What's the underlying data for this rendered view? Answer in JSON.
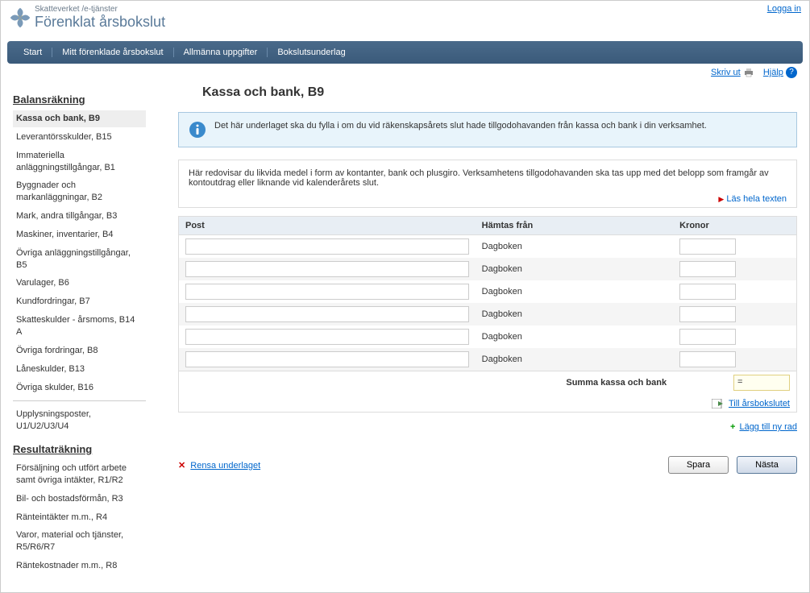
{
  "header": {
    "login": "Logga in",
    "subtitle": "Skatteverket /e-tjänster",
    "title": "Förenklat årsbokslut"
  },
  "nav": [
    "Start",
    "Mitt förenklade årsbokslut",
    "Allmänna uppgifter",
    "Bokslutsunderlag"
  ],
  "toolbar": {
    "print": "Skriv ut",
    "help": "Hjälp"
  },
  "sidebar": {
    "balans": {
      "title": "Balansräkning",
      "items": [
        "Kassa och bank, B9",
        "Leverantörsskulder, B15",
        "Immateriella anläggningstillgångar, B1",
        "Byggnader och markanläggningar, B2",
        "Mark, andra tillgångar, B3",
        "Maskiner, inventarier, B4",
        "Övriga anläggningstillgångar, B5",
        "Varulager, B6",
        "Kundfordringar, B7",
        "Skatteskulder - årsmoms, B14 A",
        "Övriga fordringar, B8",
        "Låneskulder, B13",
        "Övriga skulder, B16"
      ],
      "extra": "Upplysningsposter, U1/U2/U3/U4"
    },
    "resultat": {
      "title": "Resultaträkning",
      "items": [
        "Försäljning och utfört arbete samt övriga intäkter, R1/R2",
        "Bil- och bostadsförmån, R3",
        "Ränteintäkter m.m., R4",
        "Varor, material och tjänster, R5/R6/R7",
        "Räntekostnader m.m., R8"
      ]
    }
  },
  "content": {
    "title": "Kassa och bank, B9",
    "info": "Det här underlaget ska du fylla i om du vid räkenskapsårets slut hade tillgodohavanden från kassa och bank i din verksamhet.",
    "desc": "Här redovisar du likvida medel i form av kontanter, bank och plusgiro. Verksamhetens tillgodohavanden ska tas upp med det belopp som framgår av kontoutdrag eller liknande vid kalenderårets slut.",
    "read_more": "Läs hela texten",
    "columns": {
      "post": "Post",
      "from": "Hämtas från",
      "kr": "Kronor"
    },
    "rows": [
      {
        "post": "",
        "from": "Dagboken",
        "kr": ""
      },
      {
        "post": "",
        "from": "Dagboken",
        "kr": ""
      },
      {
        "post": "",
        "from": "Dagboken",
        "kr": ""
      },
      {
        "post": "",
        "from": "Dagboken",
        "kr": ""
      },
      {
        "post": "",
        "from": "Dagboken",
        "kr": ""
      },
      {
        "post": "",
        "from": "Dagboken",
        "kr": ""
      }
    ],
    "sum_label": "Summa kassa och bank",
    "sum_value": "=",
    "goto": "Till årsbokslutet",
    "add_row": "Lägg till ny rad",
    "clear": "Rensa underlaget",
    "save": "Spara",
    "next": "Nästa"
  }
}
